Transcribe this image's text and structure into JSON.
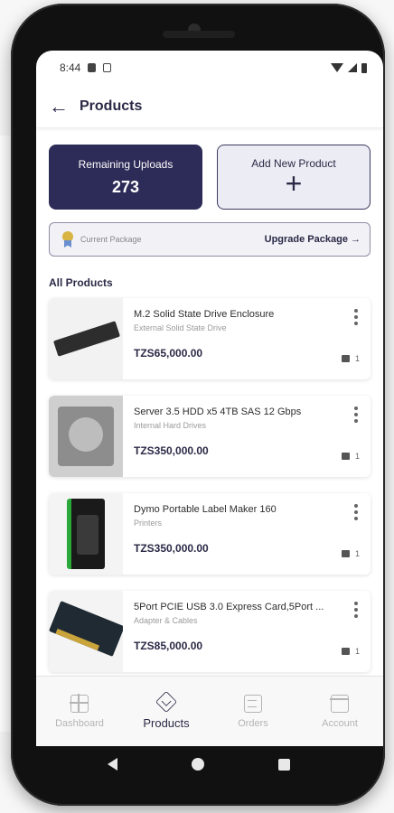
{
  "status_bar": {
    "time": "8:44"
  },
  "app_bar": {
    "title": "Products"
  },
  "uploads": {
    "title": "Remaining Uploads",
    "count": "273"
  },
  "add_product": {
    "title": "Add New Product",
    "icon": "+"
  },
  "package": {
    "current_label": "Current Package",
    "upgrade_label": "Upgrade Package →"
  },
  "section_title": "All Products",
  "products": [
    {
      "name": "M.2 Solid State Drive Enclosure",
      "category": "External Solid State Drive",
      "price": "TZS65,000.00",
      "stock": "1"
    },
    {
      "name": "Server 3.5 HDD x5 4TB SAS 12 Gbps",
      "category": "Internal Hard Drives",
      "price": "TZS350,000.00",
      "stock": "1"
    },
    {
      "name": "Dymo Portable Label Maker 160",
      "category": "Printers",
      "price": "TZS350,000.00",
      "stock": "1"
    },
    {
      "name": "5Port PCIE USB 3.0 Express Card,5Port ...",
      "category": "Adapter & Cables",
      "price": "TZS85,000.00",
      "stock": "1"
    }
  ],
  "bottom_nav": [
    {
      "label": "Dashboard",
      "icon": "grid-icon"
    },
    {
      "label": "Products",
      "icon": "cube-icon",
      "active": true
    },
    {
      "label": "Orders",
      "icon": "document-icon"
    },
    {
      "label": "Account",
      "icon": "store-icon"
    }
  ],
  "colors": {
    "primary": "#2d2b57",
    "accent_medal": "#d8b445"
  }
}
